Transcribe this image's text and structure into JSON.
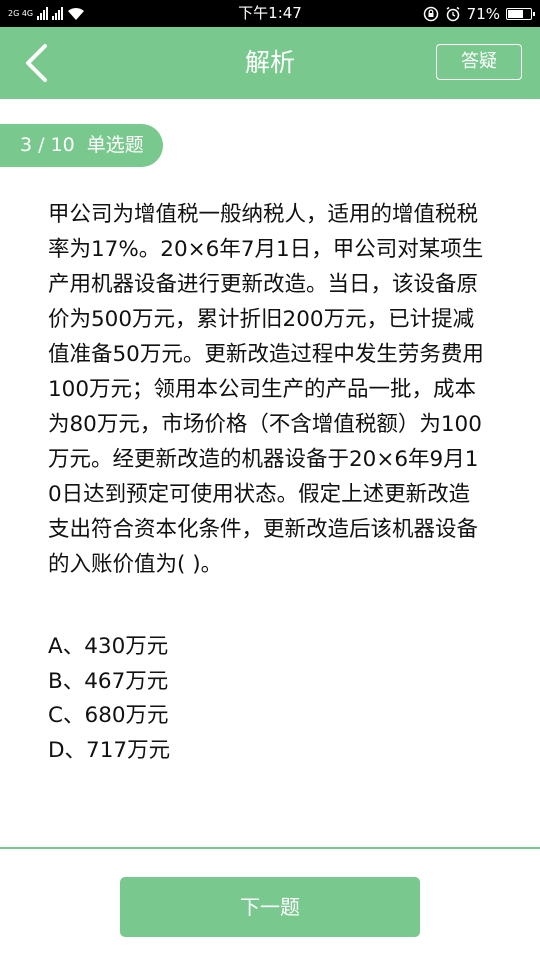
{
  "status_bar": {
    "network": "2G 4G",
    "time": "下午1:47",
    "battery_text": "71%",
    "battery_level": 0.71
  },
  "header": {
    "title": "解析",
    "ask_button": "答疑"
  },
  "badge": {
    "progress": "3 / 10",
    "type": "单选题"
  },
  "question": {
    "text": "甲公司为增值税一般纳税人，适用的增值税税率为17%。20×6年7月1日，甲公司对某项生产用机器设备进行更新改造。当日，该设备原价为500万元，累计折旧200万元，已计提减值准备50万元。更新改造过程中发生劳务费用100万元；领用本公司生产的产品一批，成本为80万元，市场价格（不含增值税额）为100万元。经更新改造的机器设备于20×6年9月10日达到预定可使用状态。假定上述更新改造支出符合资本化条件，更新改造后该机器设备的入账价值为( )。",
    "options": [
      "A、430万元",
      "B、467万元",
      "C、680万元",
      "D、717万元"
    ]
  },
  "footer": {
    "next_button": "下一题"
  },
  "colors": {
    "accent": "#79c98e",
    "status_bar": "#000000",
    "text": "#111111"
  }
}
